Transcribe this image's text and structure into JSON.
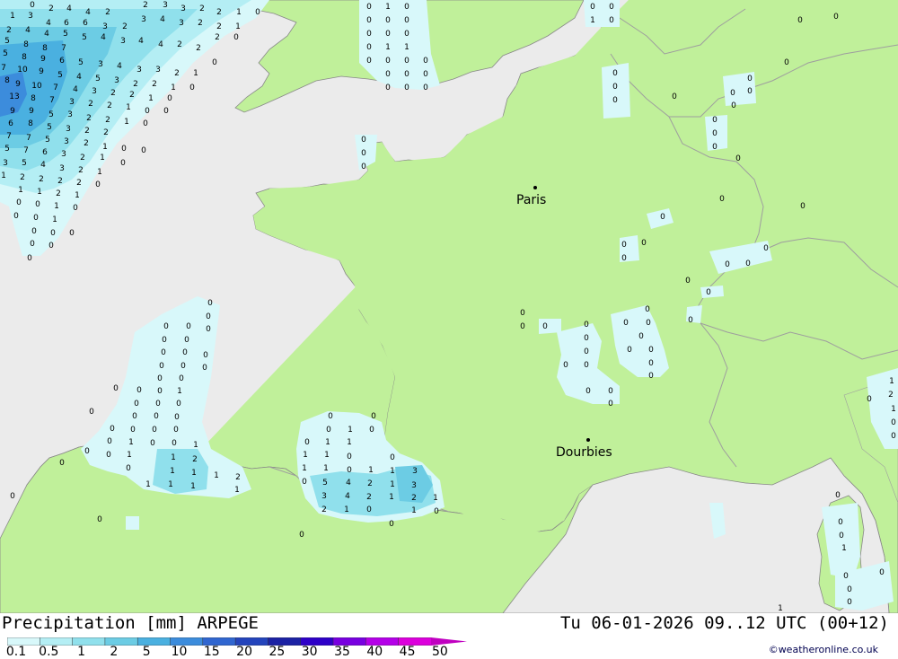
{
  "map": {
    "colors": {
      "sea": "#ebebeb",
      "land": "#c0f09a",
      "border": "#9e9e9e",
      "coast": "#888888"
    },
    "cities": [
      {
        "name": "Paris"
      },
      {
        "name": "Dourbies"
      }
    ],
    "precip_values": [
      "0",
      "1",
      "2",
      "3",
      "4",
      "5",
      "6",
      "7",
      "8",
      "9",
      "10",
      "13"
    ]
  },
  "footer": {
    "title": "Precipitation [mm] ARPEGE",
    "timestamp": "Tu 06-01-2026 09..12 UTC (00+12)",
    "credit": "©weatheronline.co.uk",
    "legend_ticks": [
      "0.1",
      "0.5",
      "1",
      "2",
      "5",
      "10",
      "15",
      "20",
      "25",
      "30",
      "35",
      "40",
      "45",
      "50"
    ],
    "legend_colors": [
      "#d8f8fa",
      "#b4eef4",
      "#90e0ec",
      "#6ccce4",
      "#4ab0e0",
      "#3c8cdc",
      "#3066d0",
      "#2444bc",
      "#1c22a4",
      "#2e00c8",
      "#7800e0",
      "#b400e8",
      "#dc00dc",
      "#c000c0"
    ]
  }
}
